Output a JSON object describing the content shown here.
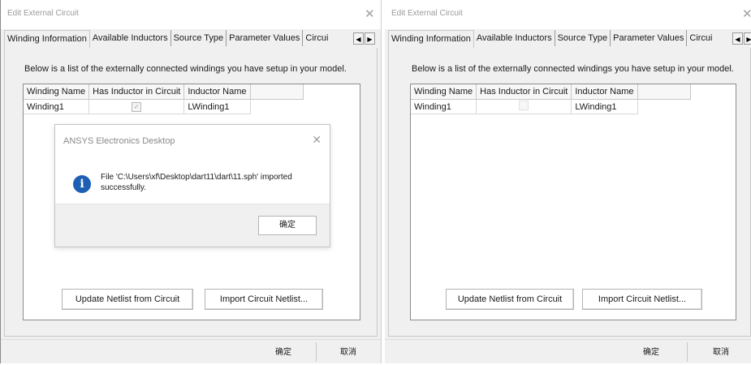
{
  "left_window": {
    "title": "Edit External Circuit",
    "tabs": [
      "Winding Information",
      "Available Inductors",
      "Source Type",
      "Parameter Values",
      "Circui"
    ],
    "description": "Below is a list of the externally connected windings you have setup in your model.",
    "table": {
      "columns": [
        "Winding Name",
        "Has Inductor in Circuit",
        "Inductor Name"
      ],
      "rows": [
        {
          "winding_name": "Winding1",
          "has_inductor": "checked",
          "inductor_name": "LWinding1"
        }
      ]
    },
    "update_button": "Update Netlist from Circuit",
    "import_button": "Import Circuit Netlist...",
    "ok_button": "确定",
    "cancel_button": "取消",
    "message_box": {
      "title": "ANSYS Electronics Desktop",
      "text": "File 'C:\\Users\\xf\\Desktop\\dart11\\dart\\11.sph' imported successfully.",
      "ok": "确定"
    }
  },
  "right_window": {
    "title": "Edit External Circuit",
    "tabs": [
      "Winding Information",
      "Available Inductors",
      "Source Type",
      "Parameter Values",
      "Circui"
    ],
    "description": "Below is a list of the externally connected windings you have setup in your model.",
    "table": {
      "columns": [
        "Winding Name",
        "Has Inductor in Circuit",
        "Inductor Name"
      ],
      "rows": [
        {
          "winding_name": "Winding1",
          "has_inductor": "unchecked",
          "inductor_name": "LWinding1"
        }
      ]
    },
    "update_button": "Update Netlist from Circuit",
    "import_button": "Import Circuit Netlist...",
    "ok_button": "确定",
    "cancel_button": "取消"
  },
  "icons": {
    "close": "close-icon",
    "scroll_left": "arrow-left-icon",
    "scroll_right": "arrow-right-icon",
    "info": "info-icon"
  },
  "colors": {
    "info_icon": "#1c5fb4",
    "dialog_bg": "#f0f0f0"
  }
}
